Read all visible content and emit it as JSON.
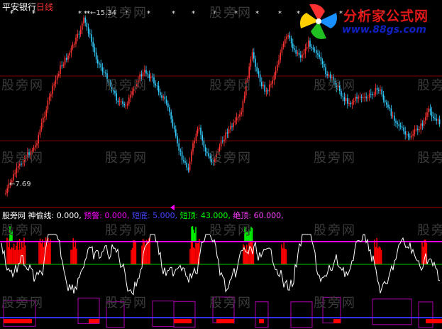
{
  "header": {
    "symbol": "平安银行",
    "period": "日线",
    "high_label": "15.34",
    "low_label": "7.69"
  },
  "indicator": {
    "source": "股旁网",
    "name": "神偷线:",
    "value": "0.000,",
    "params": [
      {
        "label": "预警:",
        "value": "0.000,",
        "color": "#ff00ff"
      },
      {
        "label": "短底:",
        "value": "5.000,",
        "color": "#3b3bff"
      },
      {
        "label": "短顶:",
        "value": "43.000,",
        "color": "#00ff00"
      },
      {
        "label": "绝顶:",
        "value": "60.000,",
        "color": "#ff40ff"
      }
    ]
  },
  "watermark": "股旁网",
  "logo": {
    "text": "分析家公式网",
    "url": "www.88gs.com"
  },
  "colors": {
    "up": "#ff3333",
    "down": "#33ccff",
    "grid": "#800000",
    "line_top": "#ff00ff",
    "line_short_top": "#00cc00",
    "line_bottom": "#3030ff",
    "signal_green": "#00ff00",
    "signal_red": "#ff0000",
    "white": "#ffffff"
  }
}
